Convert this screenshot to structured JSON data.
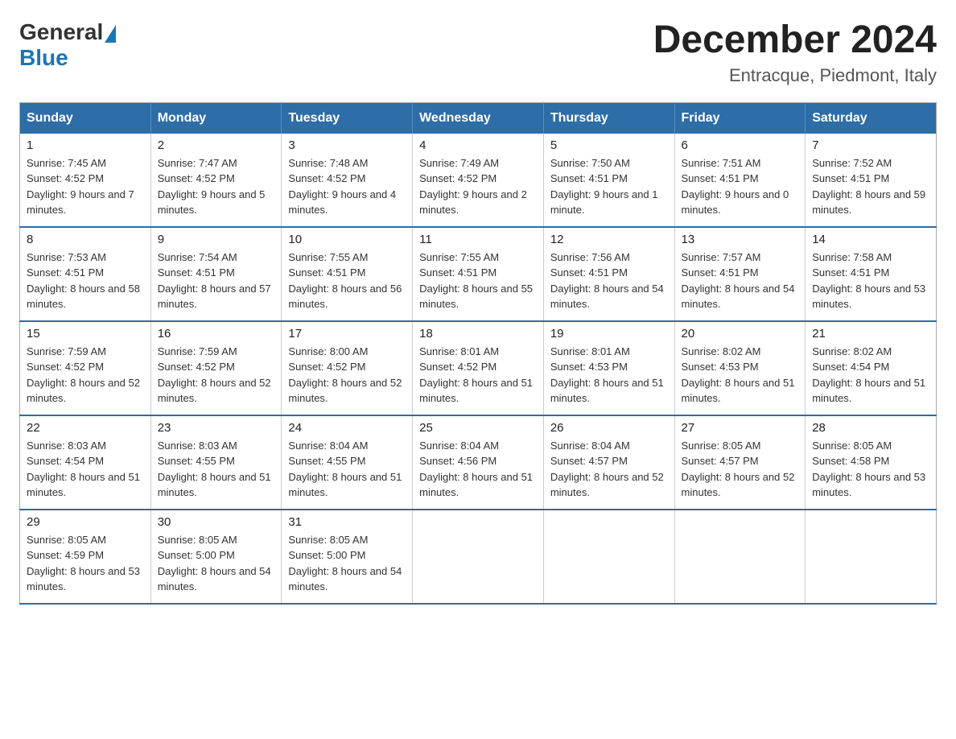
{
  "header": {
    "logo": {
      "general": "General",
      "blue": "Blue"
    },
    "title": "December 2024",
    "location": "Entracque, Piedmont, Italy"
  },
  "calendar": {
    "days_of_week": [
      "Sunday",
      "Monday",
      "Tuesday",
      "Wednesday",
      "Thursday",
      "Friday",
      "Saturday"
    ],
    "weeks": [
      [
        {
          "day": "1",
          "sunrise": "7:45 AM",
          "sunset": "4:52 PM",
          "daylight": "9 hours and 7 minutes."
        },
        {
          "day": "2",
          "sunrise": "7:47 AM",
          "sunset": "4:52 PM",
          "daylight": "9 hours and 5 minutes."
        },
        {
          "day": "3",
          "sunrise": "7:48 AM",
          "sunset": "4:52 PM",
          "daylight": "9 hours and 4 minutes."
        },
        {
          "day": "4",
          "sunrise": "7:49 AM",
          "sunset": "4:52 PM",
          "daylight": "9 hours and 2 minutes."
        },
        {
          "day": "5",
          "sunrise": "7:50 AM",
          "sunset": "4:51 PM",
          "daylight": "9 hours and 1 minute."
        },
        {
          "day": "6",
          "sunrise": "7:51 AM",
          "sunset": "4:51 PM",
          "daylight": "9 hours and 0 minutes."
        },
        {
          "day": "7",
          "sunrise": "7:52 AM",
          "sunset": "4:51 PM",
          "daylight": "8 hours and 59 minutes."
        }
      ],
      [
        {
          "day": "8",
          "sunrise": "7:53 AM",
          "sunset": "4:51 PM",
          "daylight": "8 hours and 58 minutes."
        },
        {
          "day": "9",
          "sunrise": "7:54 AM",
          "sunset": "4:51 PM",
          "daylight": "8 hours and 57 minutes."
        },
        {
          "day": "10",
          "sunrise": "7:55 AM",
          "sunset": "4:51 PM",
          "daylight": "8 hours and 56 minutes."
        },
        {
          "day": "11",
          "sunrise": "7:55 AM",
          "sunset": "4:51 PM",
          "daylight": "8 hours and 55 minutes."
        },
        {
          "day": "12",
          "sunrise": "7:56 AM",
          "sunset": "4:51 PM",
          "daylight": "8 hours and 54 minutes."
        },
        {
          "day": "13",
          "sunrise": "7:57 AM",
          "sunset": "4:51 PM",
          "daylight": "8 hours and 54 minutes."
        },
        {
          "day": "14",
          "sunrise": "7:58 AM",
          "sunset": "4:51 PM",
          "daylight": "8 hours and 53 minutes."
        }
      ],
      [
        {
          "day": "15",
          "sunrise": "7:59 AM",
          "sunset": "4:52 PM",
          "daylight": "8 hours and 52 minutes."
        },
        {
          "day": "16",
          "sunrise": "7:59 AM",
          "sunset": "4:52 PM",
          "daylight": "8 hours and 52 minutes."
        },
        {
          "day": "17",
          "sunrise": "8:00 AM",
          "sunset": "4:52 PM",
          "daylight": "8 hours and 52 minutes."
        },
        {
          "day": "18",
          "sunrise": "8:01 AM",
          "sunset": "4:52 PM",
          "daylight": "8 hours and 51 minutes."
        },
        {
          "day": "19",
          "sunrise": "8:01 AM",
          "sunset": "4:53 PM",
          "daylight": "8 hours and 51 minutes."
        },
        {
          "day": "20",
          "sunrise": "8:02 AM",
          "sunset": "4:53 PM",
          "daylight": "8 hours and 51 minutes."
        },
        {
          "day": "21",
          "sunrise": "8:02 AM",
          "sunset": "4:54 PM",
          "daylight": "8 hours and 51 minutes."
        }
      ],
      [
        {
          "day": "22",
          "sunrise": "8:03 AM",
          "sunset": "4:54 PM",
          "daylight": "8 hours and 51 minutes."
        },
        {
          "day": "23",
          "sunrise": "8:03 AM",
          "sunset": "4:55 PM",
          "daylight": "8 hours and 51 minutes."
        },
        {
          "day": "24",
          "sunrise": "8:04 AM",
          "sunset": "4:55 PM",
          "daylight": "8 hours and 51 minutes."
        },
        {
          "day": "25",
          "sunrise": "8:04 AM",
          "sunset": "4:56 PM",
          "daylight": "8 hours and 51 minutes."
        },
        {
          "day": "26",
          "sunrise": "8:04 AM",
          "sunset": "4:57 PM",
          "daylight": "8 hours and 52 minutes."
        },
        {
          "day": "27",
          "sunrise": "8:05 AM",
          "sunset": "4:57 PM",
          "daylight": "8 hours and 52 minutes."
        },
        {
          "day": "28",
          "sunrise": "8:05 AM",
          "sunset": "4:58 PM",
          "daylight": "8 hours and 53 minutes."
        }
      ],
      [
        {
          "day": "29",
          "sunrise": "8:05 AM",
          "sunset": "4:59 PM",
          "daylight": "8 hours and 53 minutes."
        },
        {
          "day": "30",
          "sunrise": "8:05 AM",
          "sunset": "5:00 PM",
          "daylight": "8 hours and 54 minutes."
        },
        {
          "day": "31",
          "sunrise": "8:05 AM",
          "sunset": "5:00 PM",
          "daylight": "8 hours and 54 minutes."
        },
        null,
        null,
        null,
        null
      ]
    ]
  }
}
